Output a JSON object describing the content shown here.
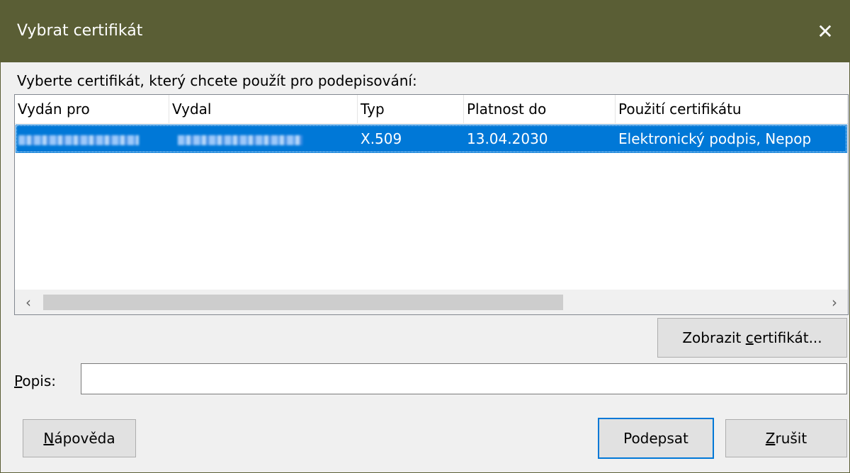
{
  "dialog": {
    "title": "Vybrat certifikát",
    "close_icon": "close-icon"
  },
  "instruction": "Vyberte certifikát, který chcete použít pro podepisování:",
  "table": {
    "columns": [
      "Vydán pro",
      "Vydal",
      "Typ",
      "Platnost do",
      "Použití certifikátu"
    ],
    "rows": [
      {
        "issued_to": "",
        "issued_by": "",
        "type": "X.509",
        "valid_until": "13.04.2030",
        "usage": "Elektronický podpis, Nepop"
      }
    ],
    "selected_row": 0,
    "scroll_left_icon": "chevron-left-icon",
    "scroll_right_icon": "chevron-right-icon"
  },
  "buttons": {
    "view_certificate": {
      "before": "Zobrazit ",
      "accel": "c",
      "after": "ertifikát..."
    },
    "help": {
      "accel": "N",
      "after": "ápověda"
    },
    "sign": "Podepsat",
    "cancel": {
      "accel": "Z",
      "after": "rušit"
    }
  },
  "description": {
    "label_accel": "P",
    "label_rest": "opis:",
    "value": ""
  },
  "colors": {
    "titlebar": "#5a5e35",
    "selection": "#0078d7"
  }
}
